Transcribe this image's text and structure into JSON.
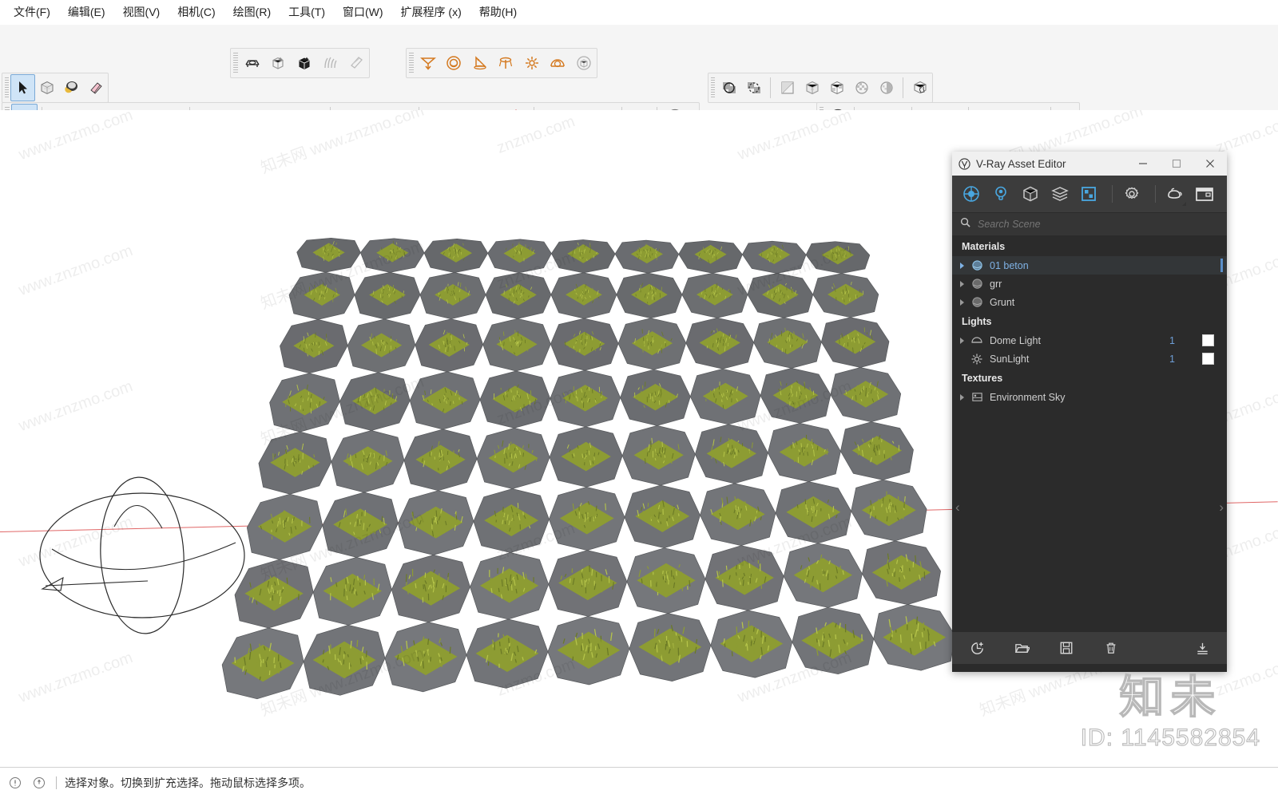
{
  "app": {
    "menu": [
      {
        "label": "文件(F)",
        "name": "menu-file"
      },
      {
        "label": "编辑(E)",
        "name": "menu-edit"
      },
      {
        "label": "视图(V)",
        "name": "menu-view"
      },
      {
        "label": "相机(C)",
        "name": "menu-camera"
      },
      {
        "label": "绘图(R)",
        "name": "menu-draw"
      },
      {
        "label": "工具(T)",
        "name": "menu-tools"
      },
      {
        "label": "窗口(W)",
        "name": "menu-window"
      },
      {
        "label": "扩展程序 (x)",
        "name": "menu-extensions"
      },
      {
        "label": "帮助(H)",
        "name": "menu-help"
      }
    ]
  },
  "toolbars": {
    "principal": [
      "select-arrow-icon",
      "make-component-icon",
      "paint-bucket-icon",
      "eraser-icon"
    ],
    "drawing": [
      "select-arrow-icon",
      "eraser-icon",
      "pencil-icon",
      "arc-icon",
      "rectangle-icon"
    ],
    "modify": [
      "pushpull-icon",
      "followme-icon",
      "move-icon",
      "rotate-icon",
      "offset-icon"
    ],
    "construction": [
      "tape-measure-icon",
      "text-icon",
      "paint-bucket-icon"
    ],
    "camera": [
      "orbit-icon",
      "pan-icon",
      "zoom-icon",
      "zoom-extents-icon"
    ],
    "warehouse": [
      "warehouse-download-icon",
      "warehouse-upload-icon",
      "warehouse-share-icon"
    ],
    "extensions": [
      "ruby-extension-icon",
      "account-icon"
    ],
    "vray_objects": [
      "vray-proxy-icon",
      "vray-fur-icon",
      "vray-clipper-icon",
      "vray-plane-icon"
    ],
    "vray_lights": [
      "rect-light-icon",
      "sphere-light-icon",
      "spot-light-icon",
      "ies-light-icon",
      "omni-light-icon",
      "dome-light-icon",
      "mesh-light-icon"
    ],
    "solid_tools": [
      "outer-shell-icon",
      "intersect-icon"
    ],
    "styles": [
      "xray-icon",
      "wireframe-icon",
      "hidden-line-icon",
      "shaded-icon",
      "texture-icon",
      "monochrome-icon"
    ],
    "vray_main": [
      "vray-logo-icon",
      "render-icon",
      "interactive-render-icon",
      "render-cloud-icon",
      "frame-buffer-icon",
      "asset-editor-icon",
      "render-settings-icon",
      "lens-effects-icon",
      "lock-icon"
    ]
  },
  "vray_editor": {
    "title": "V-Ray Asset Editor",
    "window_buttons": [
      "minimize-button",
      "maximize-button",
      "close-button"
    ],
    "tabs": [
      {
        "name": "tab-materials",
        "icon": "material-sphere-icon",
        "active": true
      },
      {
        "name": "tab-lights",
        "icon": "light-bulb-icon",
        "active": false
      },
      {
        "name": "tab-geometry",
        "icon": "geometry-cube-icon",
        "active": false
      },
      {
        "name": "tab-render-elements",
        "icon": "layers-icon",
        "active": false
      },
      {
        "name": "tab-textures",
        "icon": "texture-checker-icon",
        "active": true
      },
      {
        "name": "tab-settings",
        "icon": "gear-icon",
        "active": false
      },
      {
        "name": "tab-render",
        "icon": "teapot-icon",
        "active": false
      },
      {
        "name": "tab-frame-buffer",
        "icon": "frame-buffer-icon",
        "active": false
      }
    ],
    "search": {
      "placeholder": "Search Scene",
      "value": "",
      "icon": "search-icon"
    },
    "groups": [
      {
        "title": "Materials",
        "name": "group-materials",
        "items": [
          {
            "label": "01 beton",
            "icon": "material-sphere-icon",
            "selected": true,
            "expandable": true,
            "count": "",
            "checkbox": false
          },
          {
            "label": "grr",
            "icon": "material-sphere-icon",
            "selected": false,
            "expandable": true,
            "count": "",
            "checkbox": false
          },
          {
            "label": "Grunt",
            "icon": "material-sphere-icon",
            "selected": false,
            "expandable": true,
            "count": "",
            "checkbox": false
          }
        ]
      },
      {
        "title": "Lights",
        "name": "group-lights",
        "items": [
          {
            "label": "Dome Light",
            "icon": "dome-light-icon",
            "selected": false,
            "expandable": true,
            "count": "1",
            "checkbox": true
          },
          {
            "label": "SunLight",
            "icon": "sun-light-icon",
            "selected": false,
            "expandable": false,
            "count": "1",
            "checkbox": true
          }
        ]
      },
      {
        "title": "Textures",
        "name": "group-textures",
        "items": [
          {
            "label": "Environment Sky",
            "icon": "sky-texture-icon",
            "selected": false,
            "expandable": true,
            "count": "",
            "checkbox": false
          }
        ]
      }
    ],
    "footer_buttons": [
      {
        "name": "add-asset-button",
        "icon": "add-asset-icon"
      },
      {
        "name": "open-asset-button",
        "icon": "folder-open-icon"
      },
      {
        "name": "save-asset-button",
        "icon": "save-disk-icon"
      },
      {
        "name": "delete-asset-button",
        "icon": "trash-icon"
      },
      {
        "name": "import-asset-button",
        "icon": "import-icon"
      }
    ],
    "collapse_left_icon": "chevron-left-icon",
    "collapse_right_icon": "chevron-right-icon"
  },
  "viewport": {
    "model_name": "grass-paver-field",
    "dome_light_gizmo": "dome-light-gizmo",
    "red_axis": "red-axis-line",
    "colors": {
      "paver_top": "#74767a",
      "paver_top_light": "#8a8c8f",
      "paver_side": "#56585b",
      "grass_light": "#b5c44a",
      "grass_mid": "#8d9c33",
      "grass_dark": "#6b7a26",
      "background": "#ffffff",
      "axis_red": "#e06666"
    },
    "grid": {
      "cols": 9,
      "rows": 8
    }
  },
  "statusbar": {
    "icons": [
      "info-icon",
      "warning-icon"
    ],
    "message": "选择对象。切换到扩充选择。拖动鼠标选择多项。"
  },
  "watermark": {
    "logo_text": "知未",
    "id_text": "ID: 1145582854",
    "tiles": [
      "www.znzmo.com",
      "知未网 www.znzmo.com",
      "znzmo.com"
    ]
  }
}
